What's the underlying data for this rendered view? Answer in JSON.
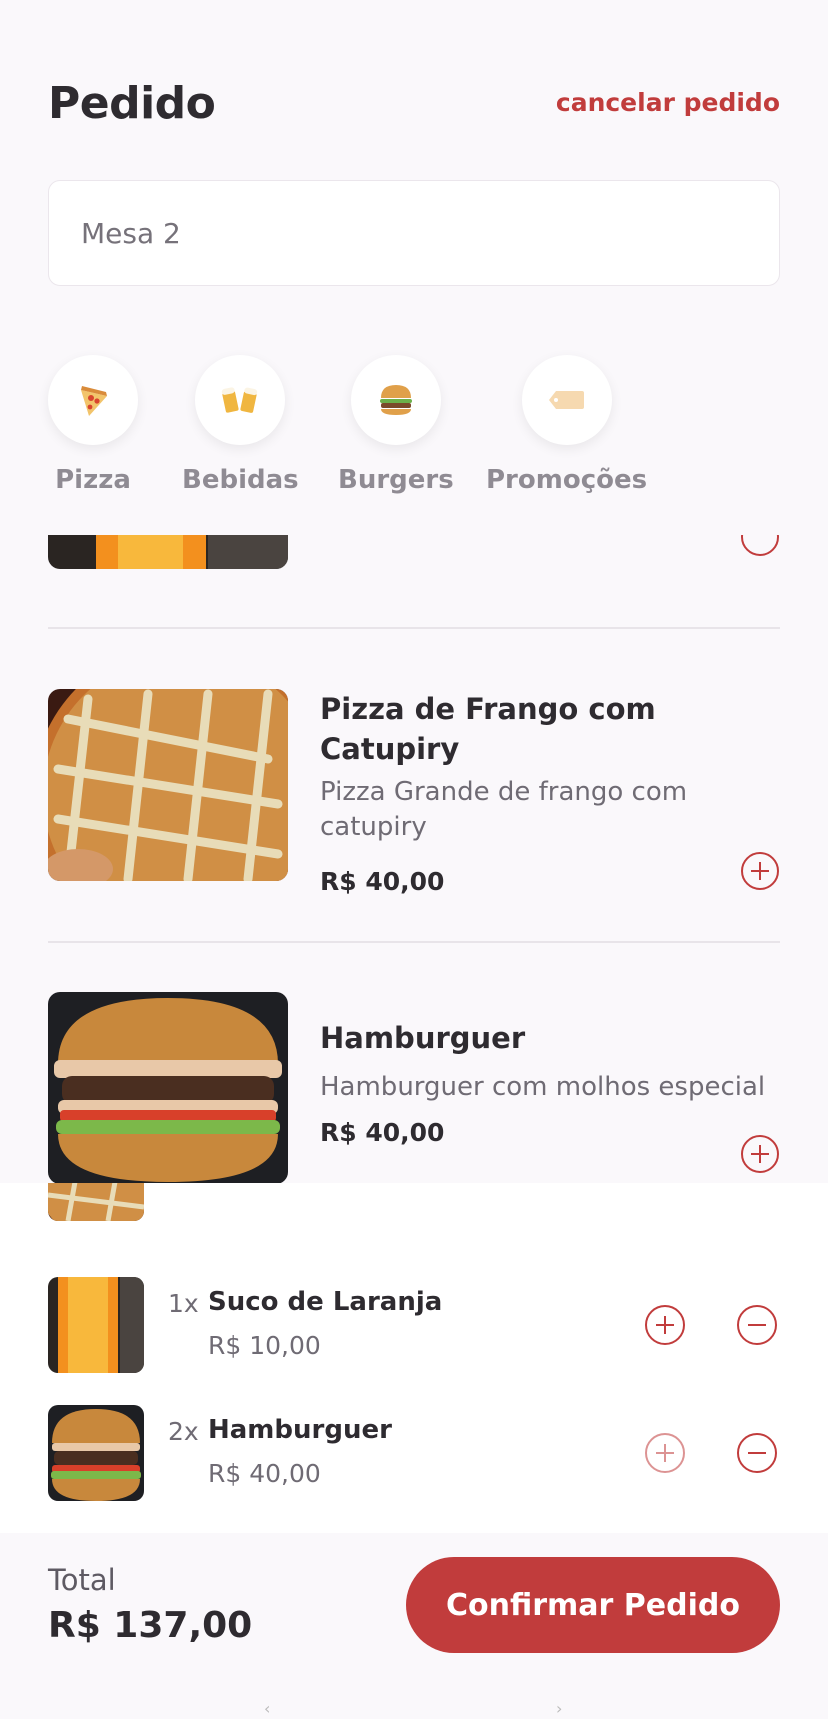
{
  "header": {
    "title": "Pedido",
    "cancel_label": "cancelar pedido"
  },
  "table_input": {
    "value": "Mesa 2"
  },
  "categories": [
    {
      "label": "Pizza",
      "icon": "pizza-icon"
    },
    {
      "label": "Bebidas",
      "icon": "beer-mugs-icon"
    },
    {
      "label": "Burgers",
      "icon": "burger-icon"
    },
    {
      "label": "Promoções",
      "icon": "price-tag-icon"
    }
  ],
  "menu": {
    "items": [
      {
        "name": "Pizza de Frango com Catupiry",
        "description": "Pizza Grande de frango com catupiry",
        "price": "R$ 40,00"
      },
      {
        "name": "Hamburguer",
        "description": "Hamburguer com molhos especial",
        "price": "R$ 40,00"
      }
    ]
  },
  "cart": {
    "items": [
      {
        "qty": "1x",
        "name": "Suco de Laranja",
        "price": "R$ 10,00"
      },
      {
        "qty": "2x",
        "name": "Hamburguer",
        "price": "R$ 40,00"
      }
    ]
  },
  "footer": {
    "total_label": "Total",
    "total_value": "R$ 137,00",
    "confirm_label": "Confirmar Pedido"
  },
  "colors": {
    "accent": "#c13c3c",
    "text": "#2e2b30",
    "muted": "#8f8b93",
    "background": "#faf8fb"
  }
}
